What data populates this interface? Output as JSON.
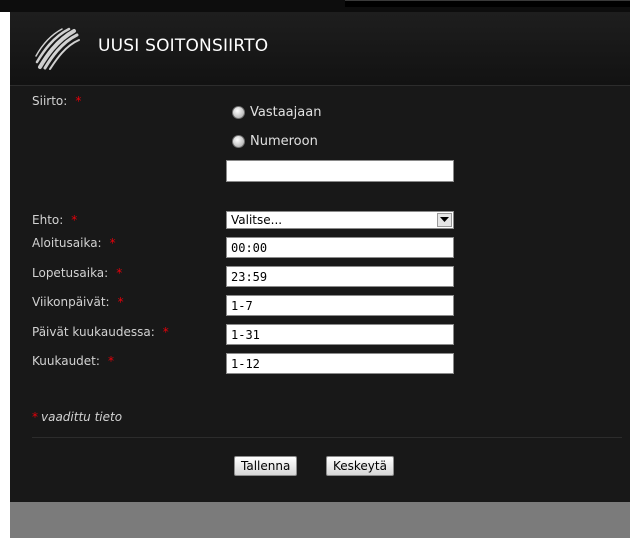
{
  "dialog": {
    "title": "UUSI SOITONSIIRTO",
    "logo_icon": "striped-wave-logo"
  },
  "form": {
    "required_mark": "*",
    "transfer": {
      "label": "Siirto:",
      "options": [
        "Vastaajaan",
        "Numeroon"
      ],
      "number_value": ""
    },
    "condition": {
      "label": "Ehto:",
      "value": "Valitse..."
    },
    "start_time": {
      "label": "Aloitusaika:",
      "value": "00:00"
    },
    "end_time": {
      "label": "Lopetusaika:",
      "value": "23:59"
    },
    "weekdays": {
      "label": "Viikonpäivät:",
      "value": "1-7"
    },
    "month_days": {
      "label": "Päivät kuukaudessa:",
      "value": "1-31"
    },
    "months": {
      "label": "Kuukaudet:",
      "value": "1-12"
    },
    "required_note": "vaadittu tieto"
  },
  "buttons": {
    "save": "Tallenna",
    "cancel": "Keskeytä"
  },
  "colors": {
    "background": "#181818",
    "required": "#e8000a",
    "footer": "#7b7b7b"
  }
}
